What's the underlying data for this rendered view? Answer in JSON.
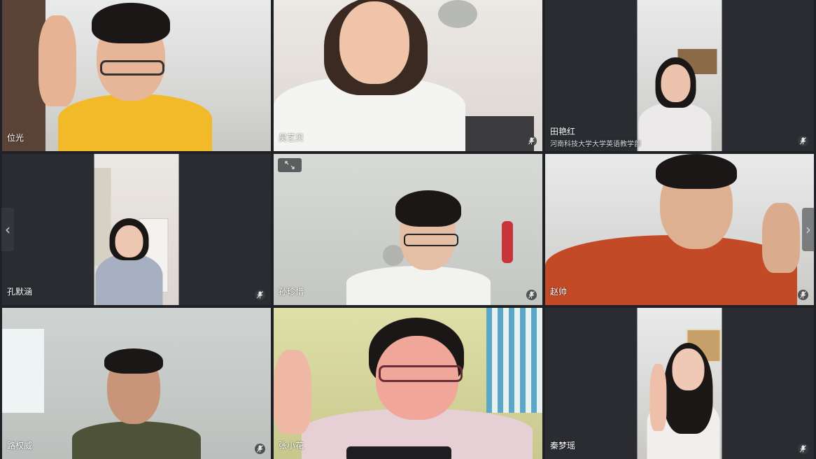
{
  "participants": [
    {
      "name": "位光",
      "subtitle": "",
      "muted": false
    },
    {
      "name": "吴艺贝",
      "subtitle": "",
      "muted": true
    },
    {
      "name": "田艳红",
      "subtitle": "河南科技大学大学英语教学部",
      "muted": true
    },
    {
      "name": "孔默涵",
      "subtitle": "",
      "muted": true
    },
    {
      "name": "孙珍惜",
      "subtitle": "",
      "muted": true
    },
    {
      "name": "赵帅",
      "subtitle": "",
      "muted": true
    },
    {
      "name": "路权威",
      "subtitle": "",
      "muted": true
    },
    {
      "name": "张小花",
      "subtitle": "",
      "muted": false
    },
    {
      "name": "秦梦瑶",
      "subtitle": "",
      "muted": true
    }
  ],
  "navigation": {
    "prev_icon": "chevron-left-icon",
    "next_icon": "chevron-right-icon",
    "prev_glyph": "‹",
    "next_glyph": "›"
  },
  "colors": {
    "background": "#1f2126",
    "tile_background": "#2a2c31",
    "label_text": "#ffffff"
  }
}
